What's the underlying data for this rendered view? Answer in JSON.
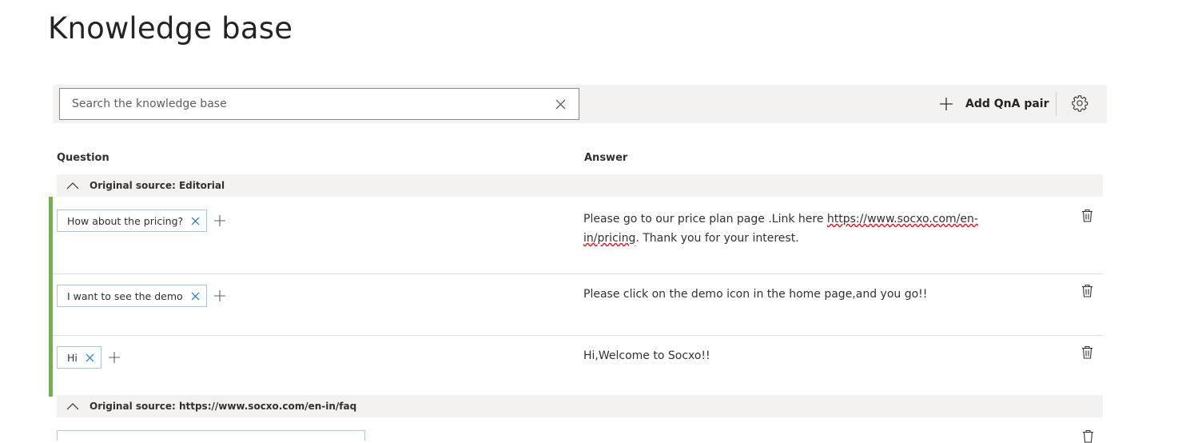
{
  "page": {
    "title": "Knowledge base"
  },
  "toolbar": {
    "search_placeholder": "Search the knowledge base",
    "search_value": "",
    "add_label": "Add QnA pair"
  },
  "table": {
    "question_header": "Question",
    "answer_header": "Answer"
  },
  "groups": [
    {
      "title": "Original source: Editorial",
      "rows": [
        {
          "question": "How about the pricing?",
          "answer_a": "Please go to our price plan page .Link here ",
          "answer_link": "https://www.socxo.com/en-in/pricing",
          "answer_b": ". Thank you for your interest."
        },
        {
          "question": "I want to see the demo",
          "answer": "Please click on the demo icon in the home page,and you go!!"
        },
        {
          "question": "Hi",
          "answer": "Hi,Welcome to Socxo!!"
        }
      ]
    },
    {
      "title": "Original source: https://www.socxo.com/en-in/faq"
    }
  ],
  "colors": {
    "accent": "#6bb843",
    "toolbar_bg": "#f3f2f1",
    "chip_border": "#a6c9e2"
  },
  "icons": [
    "close-icon",
    "plus-icon",
    "settings-gear-icon",
    "chevron-up-icon",
    "trash-icon"
  ]
}
